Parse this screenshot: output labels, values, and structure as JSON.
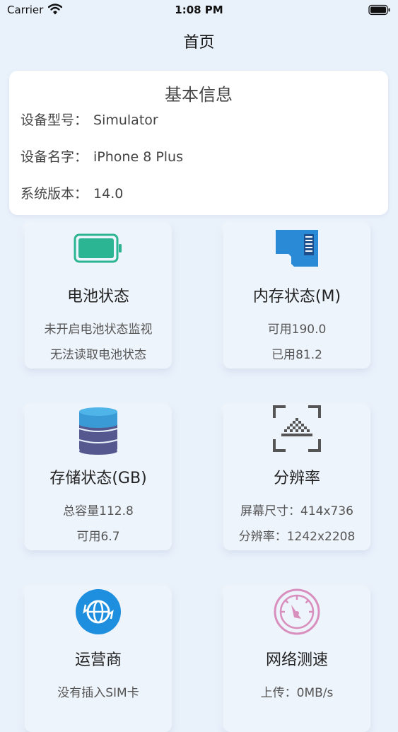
{
  "status_bar": {
    "carrier": "Carrier",
    "time": "1:08 PM"
  },
  "nav": {
    "title": "首页"
  },
  "basic_info": {
    "title": "基本信息",
    "rows": [
      {
        "label": "设备型号：",
        "value": "Simulator"
      },
      {
        "label": "设备名字：",
        "value": "iPhone 8 Plus"
      },
      {
        "label": "系统版本：",
        "value": "14.0"
      }
    ]
  },
  "cards": {
    "battery": {
      "title": "电池状态",
      "line1": "未开启电池状态监视",
      "line2": "无法读取电池状态"
    },
    "memory": {
      "title": "内存状态(M)",
      "line1_label": "可用",
      "line1_value": "190.0",
      "line2_label": "已用",
      "line2_value": "81.2"
    },
    "storage": {
      "title": "存储状态(GB)",
      "line1_label": "总容量",
      "line1_value": "112.8",
      "line2_label": "可用",
      "line2_value": "6.7"
    },
    "resolution": {
      "title": "分辨率",
      "line1_label": "屏幕尺寸：",
      "line1_value": "414x736",
      "line2_label": "分辨率：",
      "line2_value": "1242x2208"
    },
    "carrier": {
      "title": "运营商",
      "line1": "没有插入SIM卡"
    },
    "network": {
      "title": "网络测速",
      "line1_label": "上传：",
      "line1_value": "0MB/s"
    }
  },
  "icons": {
    "battery": "battery-icon",
    "memory": "sd-card-icon",
    "storage": "database-icon",
    "resolution": "scan-frame-icon",
    "carrier": "globe-icon",
    "network": "speedometer-icon"
  },
  "colors": {
    "battery_green": "#2bb593",
    "memory_blue": "#2b8ad6",
    "storage_blue": "#3a9ad6",
    "storage_purple": "#54588f",
    "carrier_blue": "#1e8fde",
    "network_pink": "#d98fbd"
  }
}
